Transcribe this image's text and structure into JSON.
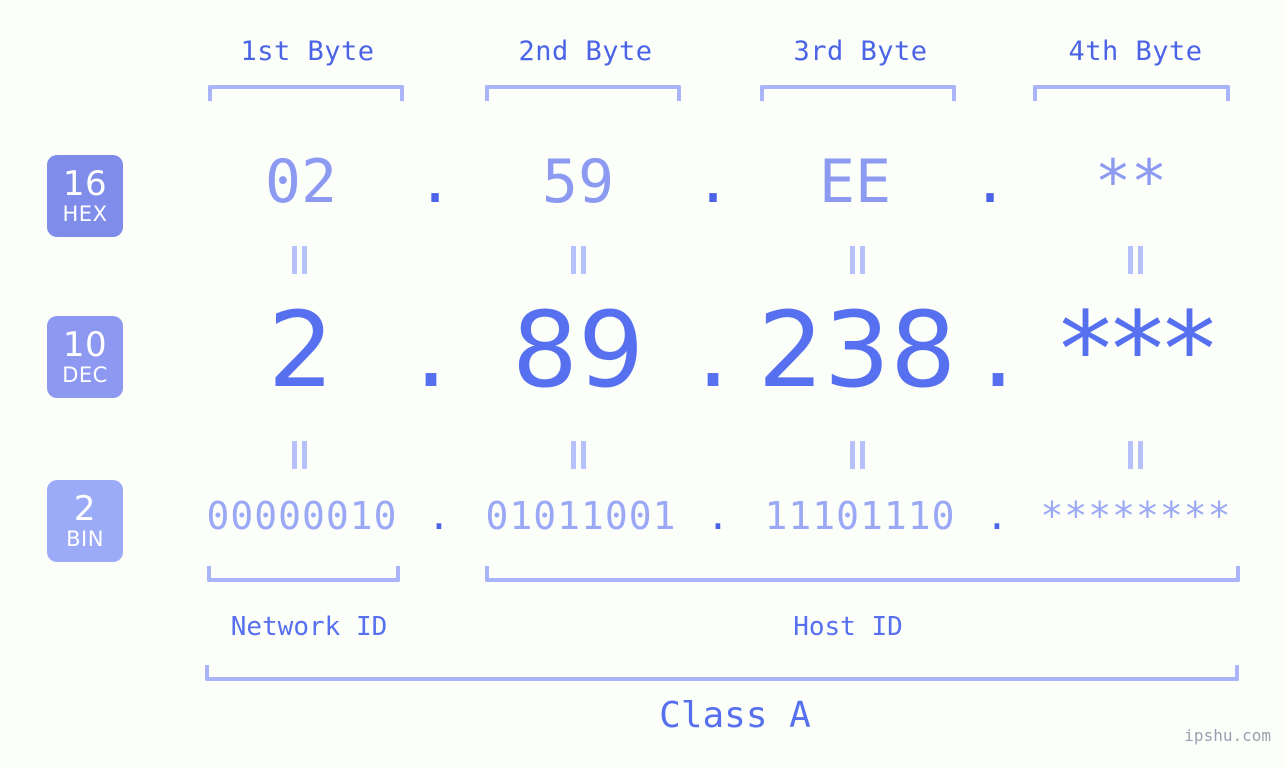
{
  "background_color": "#fcfefa",
  "accent_color": "#5670ef",
  "light_accent_color": "#aab4fb",
  "byte_headers": [
    {
      "label": "1st Byte"
    },
    {
      "label": "2nd Byte"
    },
    {
      "label": "3rd Byte"
    },
    {
      "label": "4th Byte"
    }
  ],
  "bases": [
    {
      "number": "16",
      "name": "HEX",
      "color": "#7f8ce9"
    },
    {
      "number": "10",
      "name": "DEC",
      "color": "#8d98f0"
    },
    {
      "number": "2",
      "name": "BIN",
      "color": "#9cabf7"
    }
  ],
  "rows": {
    "hex": {
      "octets": [
        "02",
        "59",
        "EE",
        "**"
      ],
      "separator": "."
    },
    "dec": {
      "octets": [
        "2",
        "89",
        "238",
        "***"
      ],
      "separator": "."
    },
    "bin": {
      "octets": [
        "00000010",
        "01011001",
        "11101110",
        "********"
      ],
      "separator": "."
    }
  },
  "equals_symbol": "=",
  "footer": {
    "network_id": "Network ID",
    "host_id": "Host ID",
    "class": "Class A"
  },
  "watermark": "ipshu.com"
}
